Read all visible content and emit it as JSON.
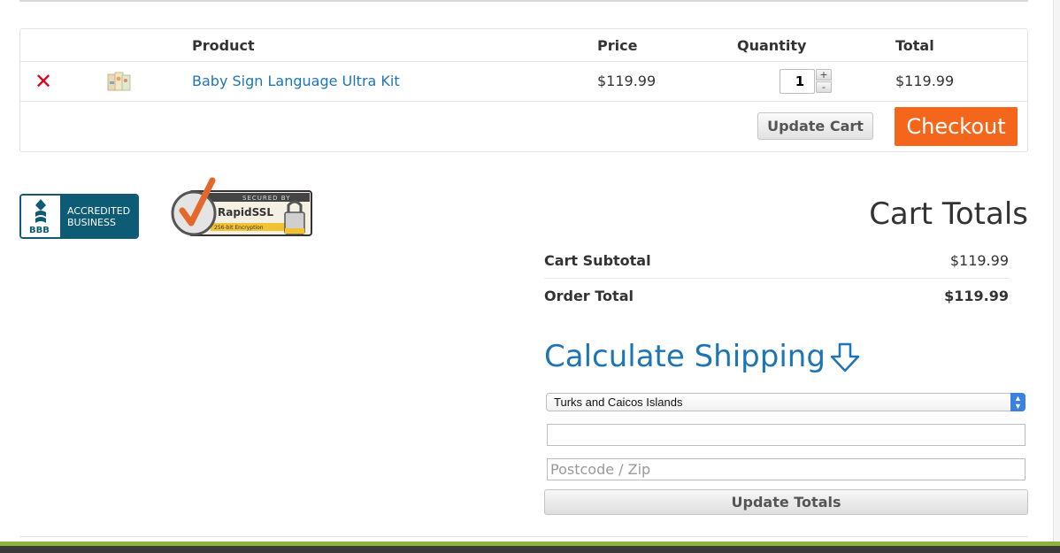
{
  "cart": {
    "headers": {
      "product": "Product",
      "price": "Price",
      "quantity": "Quantity",
      "total": "Total"
    },
    "items": [
      {
        "name": "Baby Sign Language Ultra Kit",
        "price": "$119.99",
        "quantity": "1",
        "total": "$119.99"
      }
    ],
    "update_cart_label": "Update Cart",
    "checkout_label": "Checkout",
    "remove_symbol": "✕",
    "qty_plus": "+",
    "qty_minus": "-"
  },
  "badges": {
    "bbb_lines": [
      "ACCREDITED",
      "BUSINESS"
    ],
    "bbb_logo_text": "BBB",
    "ssl_top": "SECURED BY",
    "ssl_brand": "RapidSSL",
    "ssl_sub": "256-bit Encryption"
  },
  "totals": {
    "title": "Cart Totals",
    "subtotal_label": "Cart Subtotal",
    "subtotal_value": "$119.99",
    "order_total_label": "Order Total",
    "order_total_value": "$119.99"
  },
  "shipping": {
    "title": "Calculate Shipping",
    "country_value": "Turks and Caicos Islands",
    "state_value": "",
    "zip_placeholder": "Postcode / Zip",
    "update_totals_label": "Update Totals"
  },
  "colors": {
    "link": "#1d75b5",
    "checkout": "#f4661b",
    "remove": "#e2001a",
    "bbb": "#0e5b76",
    "footer_accent": "#8ab43c"
  }
}
